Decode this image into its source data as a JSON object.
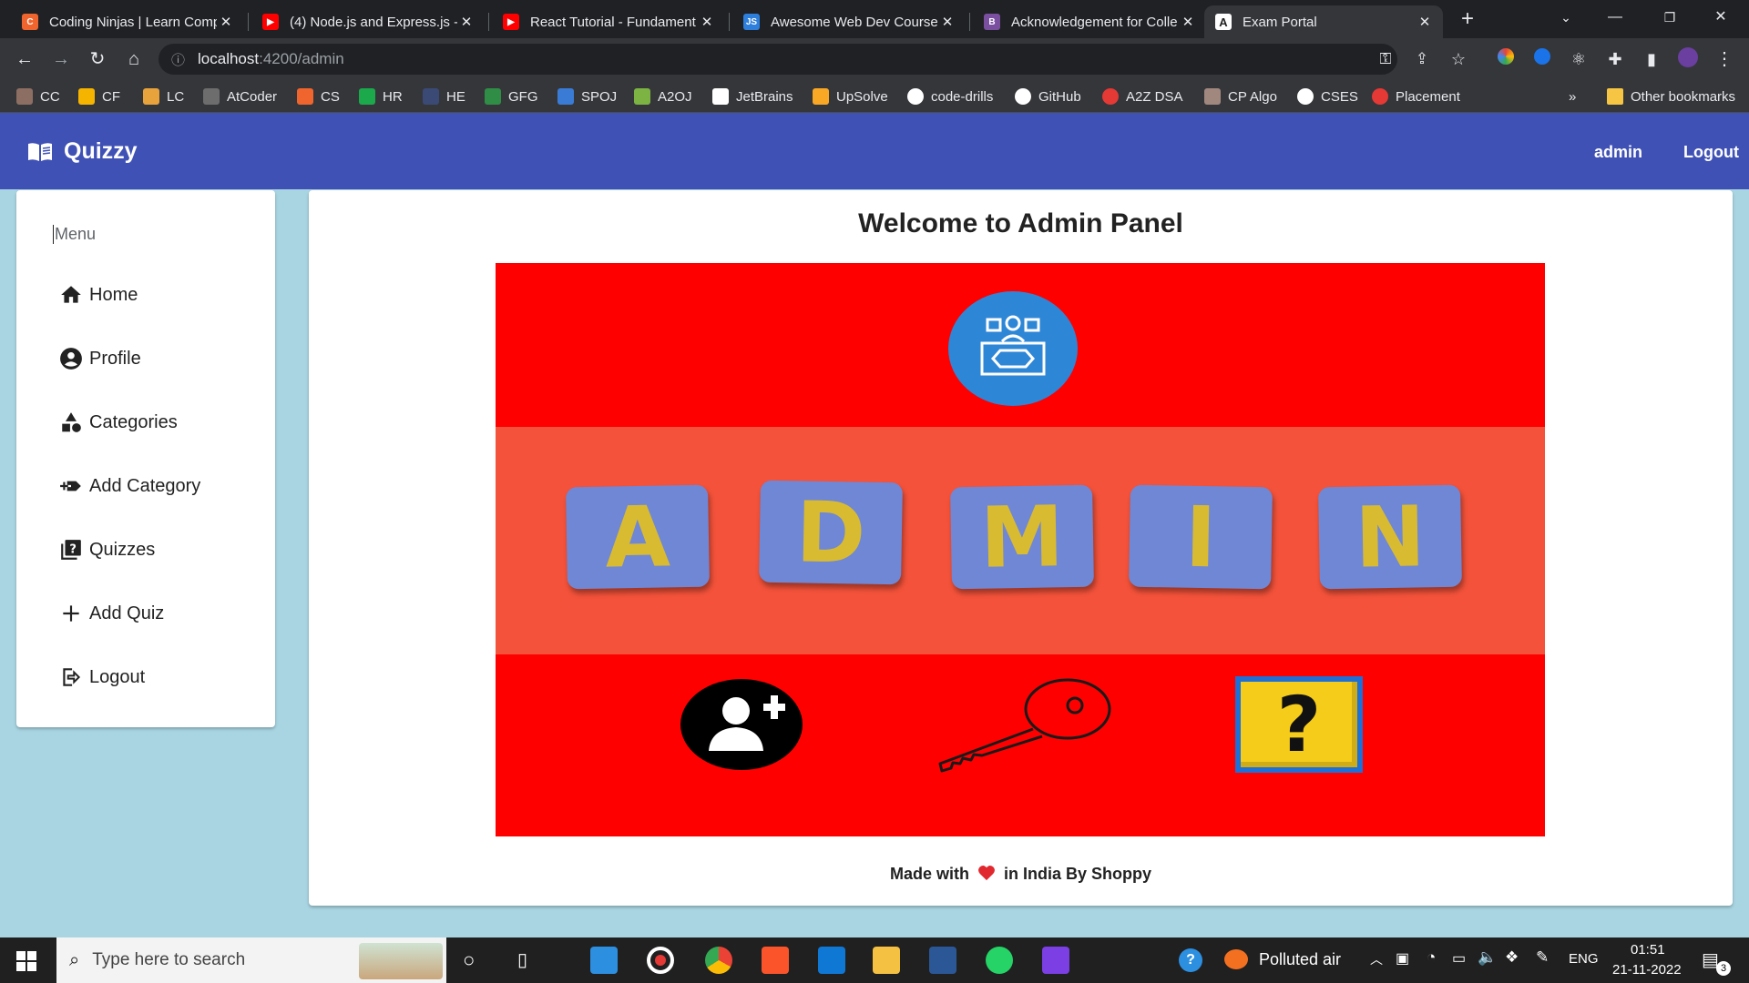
{
  "browser": {
    "tabs": [
      {
        "title": "Coding Ninjas | Learn Comp",
        "icon": "coding-ninjas-icon",
        "color": "#f0642d"
      },
      {
        "title": "(4) Node.js and Express.js -",
        "icon": "youtube-icon",
        "color": "#ff0000"
      },
      {
        "title": "React Tutorial - Fundament",
        "icon": "youtube-icon",
        "color": "#ff0000"
      },
      {
        "title": "Awesome Web Dev Courses",
        "icon": "js-icon",
        "color": "#2d7fdb"
      },
      {
        "title": "Acknowledgement for Colle",
        "icon": "b-icon",
        "color": "#7b4fa0"
      },
      {
        "title": "Exam Portal",
        "icon": "angular-icon",
        "color": "#ffffff"
      }
    ],
    "address": {
      "host": "localhost",
      "path": ":4200/admin"
    },
    "bookmarks": [
      {
        "label": "CC",
        "color": "#8d6e63"
      },
      {
        "label": "CF",
        "color": "#f5b400"
      },
      {
        "label": "LC",
        "color": "#e8a33d"
      },
      {
        "label": "AtCoder",
        "color": "#6d6d6d"
      },
      {
        "label": "CS",
        "color": "#f0642d"
      },
      {
        "label": "HR",
        "color": "#1ba94c"
      },
      {
        "label": "HE",
        "color": "#3b4a75"
      },
      {
        "label": "GFG",
        "color": "#2f8d46"
      },
      {
        "label": "SPOJ",
        "color": "#3a7bd5"
      },
      {
        "label": "A2OJ",
        "color": "#7cb342"
      },
      {
        "label": "JetBrains",
        "color": "#ffffff"
      },
      {
        "label": "UpSolve",
        "color": "#f9a825"
      },
      {
        "label": "code-drills",
        "color": "#ffffff"
      },
      {
        "label": "GitHub",
        "color": "#ffffff"
      },
      {
        "label": "A2Z DSA",
        "color": "#e53935"
      },
      {
        "label": "CP Algo",
        "color": "#a1887f"
      },
      {
        "label": "CSES",
        "color": "#ffffff"
      },
      {
        "label": "Placement",
        "color": "#e53935"
      }
    ],
    "more_bookmarks": "»",
    "other_bookmarks": "Other bookmarks"
  },
  "app": {
    "brand": "Quizzy",
    "nav": {
      "user": "admin",
      "logout": "Logout"
    },
    "accent_color": "#3f51b5"
  },
  "sidebar": {
    "heading": "Menu",
    "items": [
      {
        "label": "Home",
        "icon": "home-icon"
      },
      {
        "label": "Profile",
        "icon": "account-circle-icon"
      },
      {
        "label": "Categories",
        "icon": "category-icon"
      },
      {
        "label": "Add Category",
        "icon": "add-category-icon"
      },
      {
        "label": "Quizzes",
        "icon": "quiz-icon"
      },
      {
        "label": "Add Quiz",
        "icon": "add-icon"
      },
      {
        "label": "Logout",
        "icon": "logout-icon"
      }
    ]
  },
  "main": {
    "title": "Welcome to Admin Panel",
    "banner_letters": [
      "A",
      "D",
      "M",
      "I",
      "N"
    ],
    "footer": {
      "before": "Made with",
      "after": "in India By Shoppy"
    }
  },
  "taskbar": {
    "search_placeholder": "Type here to search",
    "weather": "Polluted air",
    "language": "ENG",
    "time": "01:51",
    "date": "21-11-2022",
    "notifications": "3"
  }
}
